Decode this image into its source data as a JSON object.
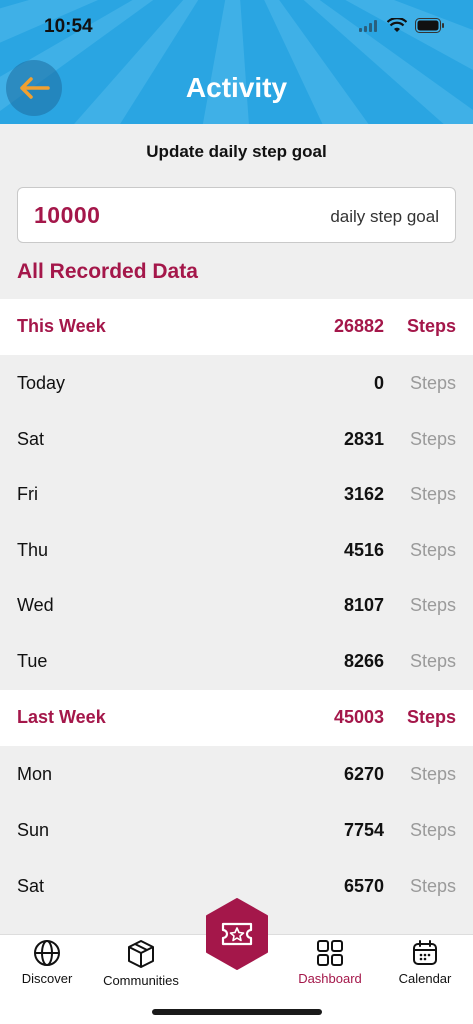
{
  "status_bar": {
    "time": "10:54"
  },
  "header": {
    "title": "Activity"
  },
  "goal": {
    "label": "Update daily step goal",
    "value": "10000",
    "unit": "daily step goal"
  },
  "section_title": "All Recorded Data",
  "this_week": {
    "label": "This Week",
    "total": "26882",
    "unit": "Steps",
    "days": [
      {
        "label": "Today",
        "value": "0",
        "unit": "Steps"
      },
      {
        "label": "Sat",
        "value": "2831",
        "unit": "Steps"
      },
      {
        "label": "Fri",
        "value": "3162",
        "unit": "Steps"
      },
      {
        "label": "Thu",
        "value": "4516",
        "unit": "Steps"
      },
      {
        "label": "Wed",
        "value": "8107",
        "unit": "Steps"
      },
      {
        "label": "Tue",
        "value": "8266",
        "unit": "Steps"
      }
    ]
  },
  "last_week": {
    "label": "Last Week",
    "total": "45003",
    "unit": "Steps",
    "days": [
      {
        "label": "Mon",
        "value": "6270",
        "unit": "Steps"
      },
      {
        "label": "Sun",
        "value": "7754",
        "unit": "Steps"
      },
      {
        "label": "Sat",
        "value": "6570",
        "unit": "Steps"
      }
    ]
  },
  "nav": {
    "items": [
      {
        "label": "Discover",
        "icon": "globe-icon"
      },
      {
        "label": "Communities",
        "icon": "cube-icon"
      },
      {
        "label": "Dashboard",
        "icon": "grid-icon",
        "active": true
      },
      {
        "label": "Calendar",
        "icon": "calendar-icon"
      }
    ],
    "center_icon": "ticket-star-icon"
  },
  "colors": {
    "accent": "#a4174a",
    "header_blue": "#2aa5e2",
    "back_arrow": "#f0a030"
  }
}
